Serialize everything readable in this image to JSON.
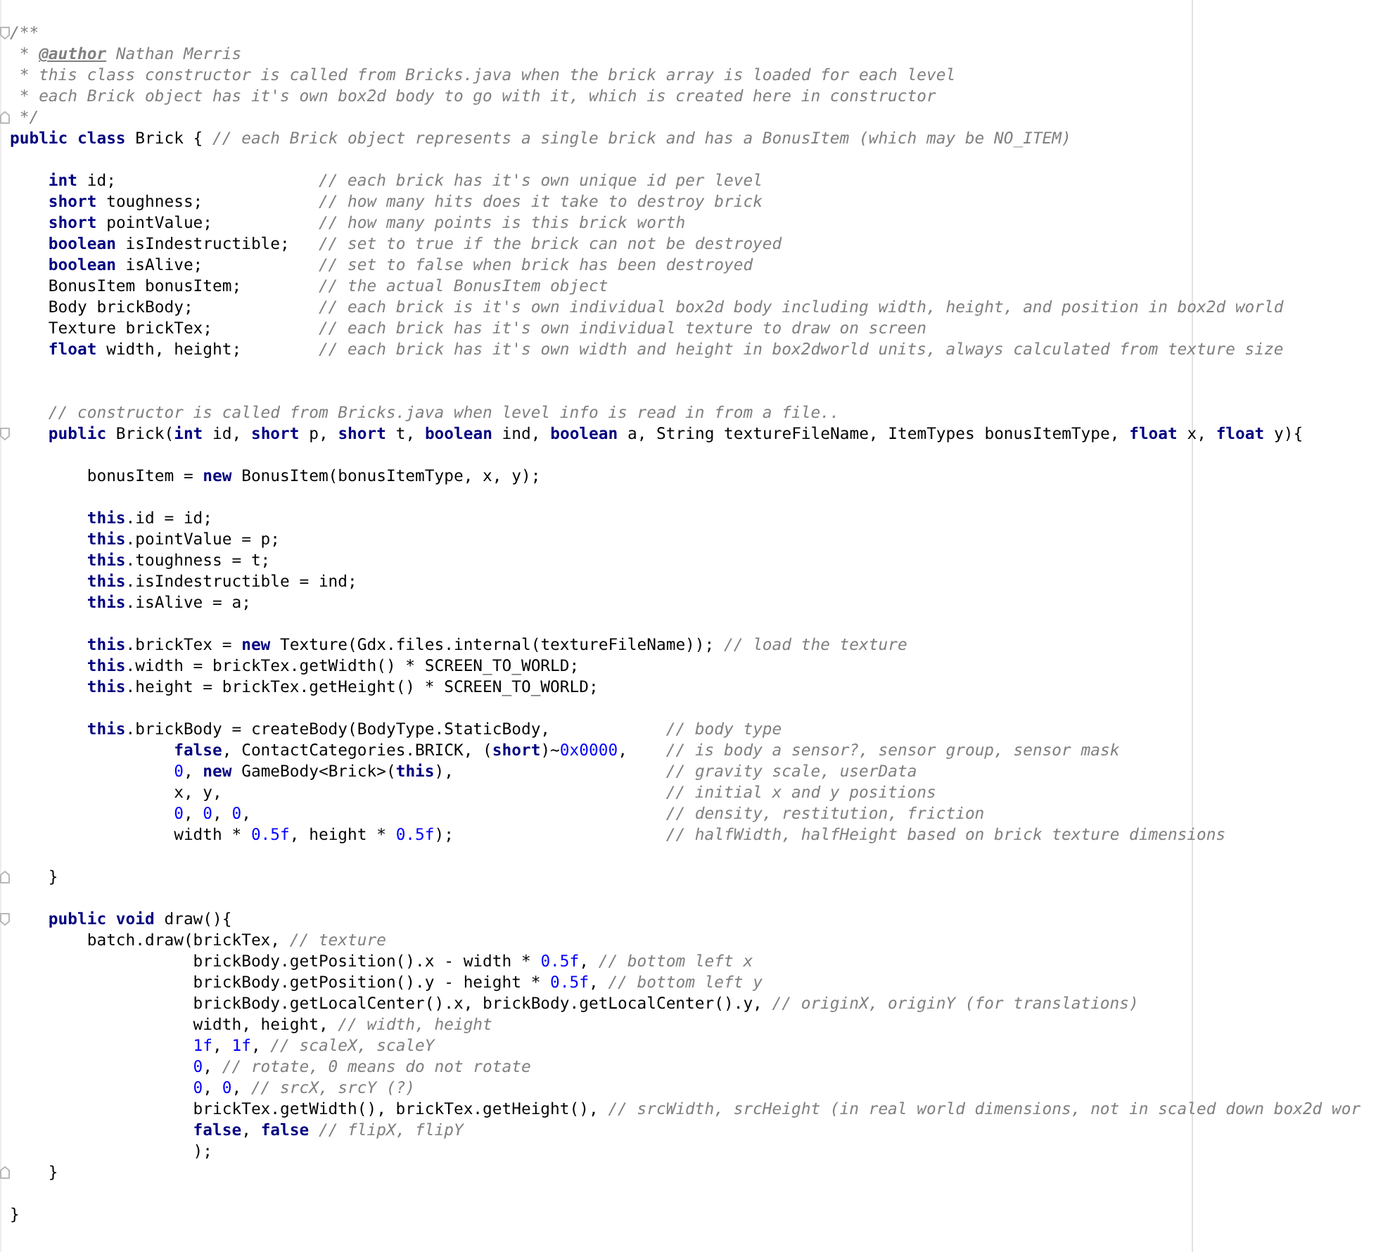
{
  "editor": {
    "lines": [
      {
        "kind": "blank"
      },
      {
        "kind": "fold-start",
        "tokens": [
          {
            "kind": "comment",
            "text": "/**"
          }
        ]
      },
      {
        "kind": "code",
        "tokens": [
          {
            "kind": "comment",
            "text": " * "
          },
          {
            "kind": "doctag",
            "text": "@author"
          },
          {
            "kind": "comment",
            "text": " Nathan Merris"
          }
        ]
      },
      {
        "kind": "code",
        "tokens": [
          {
            "kind": "comment",
            "text": " * this class constructor is called from Bricks.java when the brick array is loaded for each level"
          }
        ]
      },
      {
        "kind": "code",
        "tokens": [
          {
            "kind": "comment",
            "text": " * each Brick object has it's own box2d body to go with it, which is created here in constructor"
          }
        ]
      },
      {
        "kind": "fold-end",
        "tokens": [
          {
            "kind": "comment",
            "text": " */"
          }
        ]
      },
      {
        "kind": "code",
        "tokens": [
          {
            "kind": "keyword",
            "text": "public class"
          },
          {
            "kind": "plain",
            "text": " Brick { "
          },
          {
            "kind": "comment",
            "text": "// each Brick object represents a single brick and has a BonusItem (which may be NO_ITEM)"
          }
        ]
      },
      {
        "kind": "blank"
      },
      {
        "kind": "code",
        "tokens": [
          {
            "kind": "keyword",
            "text": "    int"
          },
          {
            "kind": "plain",
            "text": " id;                     "
          },
          {
            "kind": "comment",
            "text": "// each brick has it's own unique id per level"
          }
        ]
      },
      {
        "kind": "code",
        "tokens": [
          {
            "kind": "keyword",
            "text": "    short"
          },
          {
            "kind": "plain",
            "text": " toughness;            "
          },
          {
            "kind": "comment",
            "text": "// how many hits does it take to destroy brick"
          }
        ]
      },
      {
        "kind": "code",
        "tokens": [
          {
            "kind": "keyword",
            "text": "    short"
          },
          {
            "kind": "plain",
            "text": " pointValue;           "
          },
          {
            "kind": "comment",
            "text": "// how many points is this brick worth"
          }
        ]
      },
      {
        "kind": "code",
        "tokens": [
          {
            "kind": "keyword",
            "text": "    boolean"
          },
          {
            "kind": "plain",
            "text": " isIndestructible;   "
          },
          {
            "kind": "comment",
            "text": "// set to true if the brick can not be destroyed"
          }
        ]
      },
      {
        "kind": "code",
        "tokens": [
          {
            "kind": "keyword",
            "text": "    boolean"
          },
          {
            "kind": "plain",
            "text": " isAlive;            "
          },
          {
            "kind": "comment",
            "text": "// set to false when brick has been destroyed"
          }
        ]
      },
      {
        "kind": "code",
        "tokens": [
          {
            "kind": "plain",
            "text": "    BonusItem bonusItem;        "
          },
          {
            "kind": "comment",
            "text": "// the actual BonusItem object"
          }
        ]
      },
      {
        "kind": "code",
        "tokens": [
          {
            "kind": "plain",
            "text": "    Body brickBody;             "
          },
          {
            "kind": "comment",
            "text": "// each brick is it's own individual box2d body including width, height, and position in box2d world"
          }
        ]
      },
      {
        "kind": "code",
        "tokens": [
          {
            "kind": "plain",
            "text": "    Texture brickTex;           "
          },
          {
            "kind": "comment",
            "text": "// each brick has it's own individual texture to draw on screen"
          }
        ]
      },
      {
        "kind": "code",
        "tokens": [
          {
            "kind": "keyword",
            "text": "    float"
          },
          {
            "kind": "plain",
            "text": " width, height;        "
          },
          {
            "kind": "comment",
            "text": "// each brick has it's own width and height in box2dworld units, always calculated from texture size"
          }
        ]
      },
      {
        "kind": "blank"
      },
      {
        "kind": "blank"
      },
      {
        "kind": "code",
        "tokens": [
          {
            "kind": "comment",
            "text": "    // constructor is called from Bricks.java when level info is read in from a file.."
          }
        ]
      },
      {
        "kind": "fold-start",
        "tokens": [
          {
            "kind": "keyword",
            "text": "    public"
          },
          {
            "kind": "plain",
            "text": " Brick("
          },
          {
            "kind": "keyword",
            "text": "int"
          },
          {
            "kind": "plain",
            "text": " id, "
          },
          {
            "kind": "keyword",
            "text": "short"
          },
          {
            "kind": "plain",
            "text": " p, "
          },
          {
            "kind": "keyword",
            "text": "short"
          },
          {
            "kind": "plain",
            "text": " t, "
          },
          {
            "kind": "keyword",
            "text": "boolean"
          },
          {
            "kind": "plain",
            "text": " ind, "
          },
          {
            "kind": "keyword",
            "text": "boolean"
          },
          {
            "kind": "plain",
            "text": " a, String textureFileName, ItemTypes bonusItemType, "
          },
          {
            "kind": "keyword",
            "text": "float"
          },
          {
            "kind": "plain",
            "text": " x, "
          },
          {
            "kind": "keyword",
            "text": "float"
          },
          {
            "kind": "plain",
            "text": " y){"
          }
        ]
      },
      {
        "kind": "blank"
      },
      {
        "kind": "code",
        "tokens": [
          {
            "kind": "plain",
            "text": "        bonusItem = "
          },
          {
            "kind": "keyword",
            "text": "new"
          },
          {
            "kind": "plain",
            "text": " BonusItem(bonusItemType, x, y);"
          }
        ]
      },
      {
        "kind": "blank"
      },
      {
        "kind": "code",
        "tokens": [
          {
            "kind": "keyword",
            "text": "        this"
          },
          {
            "kind": "plain",
            "text": ".id = id;"
          }
        ]
      },
      {
        "kind": "code",
        "tokens": [
          {
            "kind": "keyword",
            "text": "        this"
          },
          {
            "kind": "plain",
            "text": ".pointValue = p;"
          }
        ]
      },
      {
        "kind": "code",
        "tokens": [
          {
            "kind": "keyword",
            "text": "        this"
          },
          {
            "kind": "plain",
            "text": ".toughness = t;"
          }
        ]
      },
      {
        "kind": "code",
        "tokens": [
          {
            "kind": "keyword",
            "text": "        this"
          },
          {
            "kind": "plain",
            "text": ".isIndestructible = ind;"
          }
        ]
      },
      {
        "kind": "code",
        "tokens": [
          {
            "kind": "keyword",
            "text": "        this"
          },
          {
            "kind": "plain",
            "text": ".isAlive = a;"
          }
        ]
      },
      {
        "kind": "blank"
      },
      {
        "kind": "code",
        "tokens": [
          {
            "kind": "keyword",
            "text": "        this"
          },
          {
            "kind": "plain",
            "text": ".brickTex = "
          },
          {
            "kind": "keyword",
            "text": "new"
          },
          {
            "kind": "plain",
            "text": " Texture(Gdx.files.internal(textureFileName)); "
          },
          {
            "kind": "comment",
            "text": "// load the texture"
          }
        ]
      },
      {
        "kind": "code",
        "tokens": [
          {
            "kind": "keyword",
            "text": "        this"
          },
          {
            "kind": "plain",
            "text": ".width = brickTex.getWidth() * SCREEN_TO_WORLD;"
          }
        ]
      },
      {
        "kind": "code",
        "tokens": [
          {
            "kind": "keyword",
            "text": "        this"
          },
          {
            "kind": "plain",
            "text": ".height = brickTex.getHeight() * SCREEN_TO_WORLD;"
          }
        ]
      },
      {
        "kind": "blank"
      },
      {
        "kind": "code",
        "tokens": [
          {
            "kind": "keyword",
            "text": "        this"
          },
          {
            "kind": "plain",
            "text": ".brickBody = createBody(BodyType.StaticBody,            "
          },
          {
            "kind": "comment",
            "text": "// body type"
          }
        ]
      },
      {
        "kind": "code",
        "tokens": [
          {
            "kind": "keyword",
            "text": "                 false"
          },
          {
            "kind": "plain",
            "text": ", ContactCategories.BRICK, ("
          },
          {
            "kind": "keyword",
            "text": "short"
          },
          {
            "kind": "plain",
            "text": ")~"
          },
          {
            "kind": "number",
            "text": "0x0000"
          },
          {
            "kind": "plain",
            "text": ",    "
          },
          {
            "kind": "comment",
            "text": "// is body a sensor?, sensor group, sensor mask"
          }
        ]
      },
      {
        "kind": "code",
        "tokens": [
          {
            "kind": "number",
            "text": "                 0"
          },
          {
            "kind": "plain",
            "text": ", "
          },
          {
            "kind": "keyword",
            "text": "new"
          },
          {
            "kind": "plain",
            "text": " GameBody<Brick>("
          },
          {
            "kind": "keyword",
            "text": "this"
          },
          {
            "kind": "plain",
            "text": "),                      "
          },
          {
            "kind": "comment",
            "text": "// gravity scale, userData"
          }
        ]
      },
      {
        "kind": "code",
        "tokens": [
          {
            "kind": "plain",
            "text": "                 x, y,                                              "
          },
          {
            "kind": "comment",
            "text": "// initial x and y positions"
          }
        ]
      },
      {
        "kind": "code",
        "tokens": [
          {
            "kind": "number",
            "text": "                 0"
          },
          {
            "kind": "plain",
            "text": ", "
          },
          {
            "kind": "number",
            "text": "0"
          },
          {
            "kind": "plain",
            "text": ", "
          },
          {
            "kind": "number",
            "text": "0"
          },
          {
            "kind": "plain",
            "text": ",                                           "
          },
          {
            "kind": "comment",
            "text": "// density, restitution, friction"
          }
        ]
      },
      {
        "kind": "code",
        "tokens": [
          {
            "kind": "plain",
            "text": "                 width * "
          },
          {
            "kind": "number",
            "text": "0.5f"
          },
          {
            "kind": "plain",
            "text": ", height * "
          },
          {
            "kind": "number",
            "text": "0.5f"
          },
          {
            "kind": "plain",
            "text": ");                      "
          },
          {
            "kind": "comment",
            "text": "// halfWidth, halfHeight based on brick texture dimensions"
          }
        ]
      },
      {
        "kind": "blank"
      },
      {
        "kind": "fold-end",
        "tokens": [
          {
            "kind": "plain",
            "text": "    }"
          }
        ]
      },
      {
        "kind": "blank"
      },
      {
        "kind": "fold-start",
        "tokens": [
          {
            "kind": "keyword",
            "text": "    public void"
          },
          {
            "kind": "plain",
            "text": " draw(){"
          }
        ]
      },
      {
        "kind": "code",
        "tokens": [
          {
            "kind": "plain",
            "text": "        batch.draw(brickTex, "
          },
          {
            "kind": "comment",
            "text": "// texture"
          }
        ]
      },
      {
        "kind": "code",
        "tokens": [
          {
            "kind": "plain",
            "text": "                   brickBody.getPosition().x - width * "
          },
          {
            "kind": "number",
            "text": "0.5f"
          },
          {
            "kind": "plain",
            "text": ", "
          },
          {
            "kind": "comment",
            "text": "// bottom left x"
          }
        ]
      },
      {
        "kind": "code",
        "tokens": [
          {
            "kind": "plain",
            "text": "                   brickBody.getPosition().y - height * "
          },
          {
            "kind": "number",
            "text": "0.5f"
          },
          {
            "kind": "plain",
            "text": ", "
          },
          {
            "kind": "comment",
            "text": "// bottom left y"
          }
        ]
      },
      {
        "kind": "code",
        "tokens": [
          {
            "kind": "plain",
            "text": "                   brickBody.getLocalCenter().x, brickBody.getLocalCenter().y, "
          },
          {
            "kind": "comment",
            "text": "// originX, originY (for translations)"
          }
        ]
      },
      {
        "kind": "code",
        "tokens": [
          {
            "kind": "plain",
            "text": "                   width, height, "
          },
          {
            "kind": "comment",
            "text": "// width, height"
          }
        ]
      },
      {
        "kind": "code",
        "tokens": [
          {
            "kind": "number",
            "text": "                   1f"
          },
          {
            "kind": "plain",
            "text": ", "
          },
          {
            "kind": "number",
            "text": "1f"
          },
          {
            "kind": "plain",
            "text": ", "
          },
          {
            "kind": "comment",
            "text": "// scaleX, scaleY"
          }
        ]
      },
      {
        "kind": "code",
        "tokens": [
          {
            "kind": "number",
            "text": "                   0"
          },
          {
            "kind": "plain",
            "text": ", "
          },
          {
            "kind": "comment",
            "text": "// rotate, 0 means do not rotate"
          }
        ]
      },
      {
        "kind": "code",
        "tokens": [
          {
            "kind": "number",
            "text": "                   0"
          },
          {
            "kind": "plain",
            "text": ", "
          },
          {
            "kind": "number",
            "text": "0"
          },
          {
            "kind": "plain",
            "text": ", "
          },
          {
            "kind": "comment",
            "text": "// srcX, srcY (?)"
          }
        ]
      },
      {
        "kind": "code",
        "tokens": [
          {
            "kind": "plain",
            "text": "                   brickTex.getWidth(), brickTex.getHeight(), "
          },
          {
            "kind": "comment",
            "text": "// srcWidth, srcHeight (in real world dimensions, not in scaled down box2d wor"
          }
        ]
      },
      {
        "kind": "code",
        "tokens": [
          {
            "kind": "keyword",
            "text": "                   false"
          },
          {
            "kind": "plain",
            "text": ", "
          },
          {
            "kind": "keyword",
            "text": "false"
          },
          {
            "kind": "comment",
            "text": " // flipX, flipY"
          }
        ]
      },
      {
        "kind": "code",
        "tokens": [
          {
            "kind": "plain",
            "text": "                   );"
          }
        ]
      },
      {
        "kind": "fold-end",
        "tokens": [
          {
            "kind": "plain",
            "text": "    }"
          }
        ]
      },
      {
        "kind": "blank"
      },
      {
        "kind": "code",
        "tokens": [
          {
            "kind": "plain",
            "text": "}"
          }
        ]
      }
    ]
  }
}
